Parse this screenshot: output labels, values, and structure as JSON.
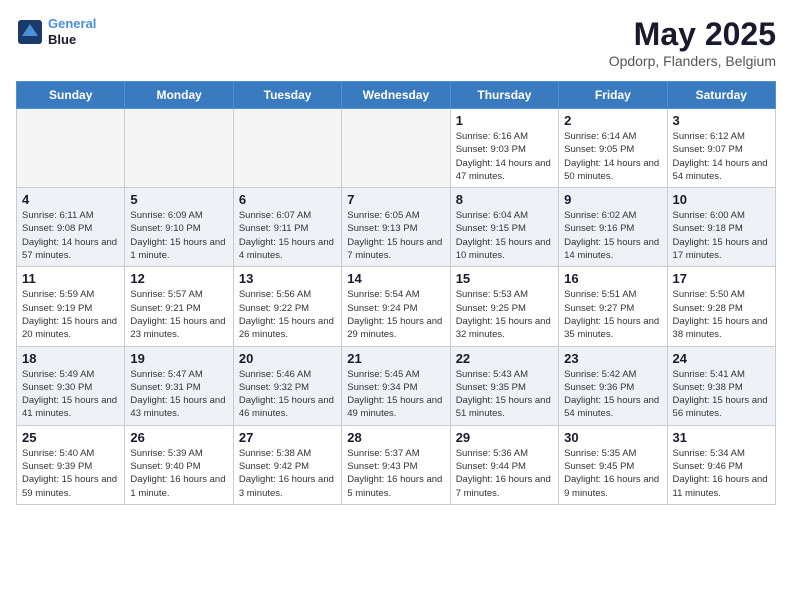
{
  "header": {
    "logo_line1": "General",
    "logo_line2": "Blue",
    "month": "May 2025",
    "location": "Opdorp, Flanders, Belgium"
  },
  "days_of_week": [
    "Sunday",
    "Monday",
    "Tuesday",
    "Wednesday",
    "Thursday",
    "Friday",
    "Saturday"
  ],
  "weeks": [
    [
      {
        "day": "",
        "text": ""
      },
      {
        "day": "",
        "text": ""
      },
      {
        "day": "",
        "text": ""
      },
      {
        "day": "",
        "text": ""
      },
      {
        "day": "1",
        "text": "Sunrise: 6:16 AM\nSunset: 9:03 PM\nDaylight: 14 hours and 47 minutes."
      },
      {
        "day": "2",
        "text": "Sunrise: 6:14 AM\nSunset: 9:05 PM\nDaylight: 14 hours and 50 minutes."
      },
      {
        "day": "3",
        "text": "Sunrise: 6:12 AM\nSunset: 9:07 PM\nDaylight: 14 hours and 54 minutes."
      }
    ],
    [
      {
        "day": "4",
        "text": "Sunrise: 6:11 AM\nSunset: 9:08 PM\nDaylight: 14 hours and 57 minutes."
      },
      {
        "day": "5",
        "text": "Sunrise: 6:09 AM\nSunset: 9:10 PM\nDaylight: 15 hours and 1 minute."
      },
      {
        "day": "6",
        "text": "Sunrise: 6:07 AM\nSunset: 9:11 PM\nDaylight: 15 hours and 4 minutes."
      },
      {
        "day": "7",
        "text": "Sunrise: 6:05 AM\nSunset: 9:13 PM\nDaylight: 15 hours and 7 minutes."
      },
      {
        "day": "8",
        "text": "Sunrise: 6:04 AM\nSunset: 9:15 PM\nDaylight: 15 hours and 10 minutes."
      },
      {
        "day": "9",
        "text": "Sunrise: 6:02 AM\nSunset: 9:16 PM\nDaylight: 15 hours and 14 minutes."
      },
      {
        "day": "10",
        "text": "Sunrise: 6:00 AM\nSunset: 9:18 PM\nDaylight: 15 hours and 17 minutes."
      }
    ],
    [
      {
        "day": "11",
        "text": "Sunrise: 5:59 AM\nSunset: 9:19 PM\nDaylight: 15 hours and 20 minutes."
      },
      {
        "day": "12",
        "text": "Sunrise: 5:57 AM\nSunset: 9:21 PM\nDaylight: 15 hours and 23 minutes."
      },
      {
        "day": "13",
        "text": "Sunrise: 5:56 AM\nSunset: 9:22 PM\nDaylight: 15 hours and 26 minutes."
      },
      {
        "day": "14",
        "text": "Sunrise: 5:54 AM\nSunset: 9:24 PM\nDaylight: 15 hours and 29 minutes."
      },
      {
        "day": "15",
        "text": "Sunrise: 5:53 AM\nSunset: 9:25 PM\nDaylight: 15 hours and 32 minutes."
      },
      {
        "day": "16",
        "text": "Sunrise: 5:51 AM\nSunset: 9:27 PM\nDaylight: 15 hours and 35 minutes."
      },
      {
        "day": "17",
        "text": "Sunrise: 5:50 AM\nSunset: 9:28 PM\nDaylight: 15 hours and 38 minutes."
      }
    ],
    [
      {
        "day": "18",
        "text": "Sunrise: 5:49 AM\nSunset: 9:30 PM\nDaylight: 15 hours and 41 minutes."
      },
      {
        "day": "19",
        "text": "Sunrise: 5:47 AM\nSunset: 9:31 PM\nDaylight: 15 hours and 43 minutes."
      },
      {
        "day": "20",
        "text": "Sunrise: 5:46 AM\nSunset: 9:32 PM\nDaylight: 15 hours and 46 minutes."
      },
      {
        "day": "21",
        "text": "Sunrise: 5:45 AM\nSunset: 9:34 PM\nDaylight: 15 hours and 49 minutes."
      },
      {
        "day": "22",
        "text": "Sunrise: 5:43 AM\nSunset: 9:35 PM\nDaylight: 15 hours and 51 minutes."
      },
      {
        "day": "23",
        "text": "Sunrise: 5:42 AM\nSunset: 9:36 PM\nDaylight: 15 hours and 54 minutes."
      },
      {
        "day": "24",
        "text": "Sunrise: 5:41 AM\nSunset: 9:38 PM\nDaylight: 15 hours and 56 minutes."
      }
    ],
    [
      {
        "day": "25",
        "text": "Sunrise: 5:40 AM\nSunset: 9:39 PM\nDaylight: 15 hours and 59 minutes."
      },
      {
        "day": "26",
        "text": "Sunrise: 5:39 AM\nSunset: 9:40 PM\nDaylight: 16 hours and 1 minute."
      },
      {
        "day": "27",
        "text": "Sunrise: 5:38 AM\nSunset: 9:42 PM\nDaylight: 16 hours and 3 minutes."
      },
      {
        "day": "28",
        "text": "Sunrise: 5:37 AM\nSunset: 9:43 PM\nDaylight: 16 hours and 5 minutes."
      },
      {
        "day": "29",
        "text": "Sunrise: 5:36 AM\nSunset: 9:44 PM\nDaylight: 16 hours and 7 minutes."
      },
      {
        "day": "30",
        "text": "Sunrise: 5:35 AM\nSunset: 9:45 PM\nDaylight: 16 hours and 9 minutes."
      },
      {
        "day": "31",
        "text": "Sunrise: 5:34 AM\nSunset: 9:46 PM\nDaylight: 16 hours and 11 minutes."
      }
    ]
  ]
}
